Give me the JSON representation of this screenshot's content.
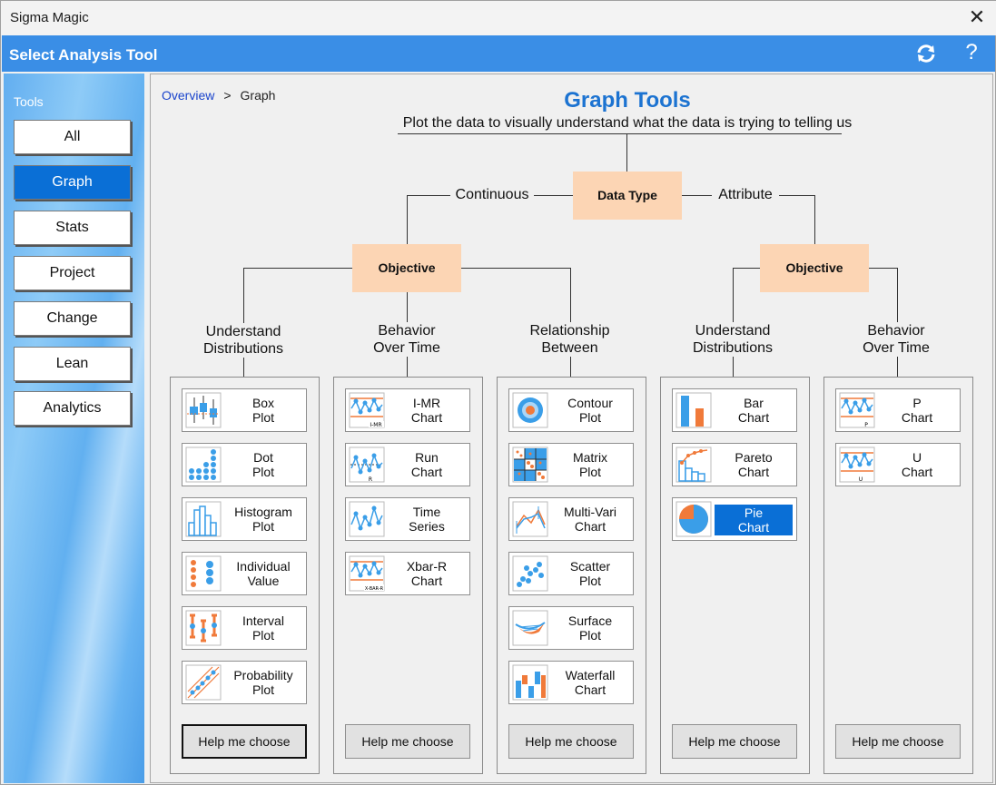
{
  "window": {
    "title": "Sigma Magic"
  },
  "header": {
    "title": "Select Analysis Tool",
    "help": "?"
  },
  "sidebar": {
    "label": "Tools",
    "items": [
      {
        "label": "All",
        "active": false
      },
      {
        "label": "Graph",
        "active": true
      },
      {
        "label": "Stats",
        "active": false
      },
      {
        "label": "Project",
        "active": false
      },
      {
        "label": "Change",
        "active": false
      },
      {
        "label": "Lean",
        "active": false
      },
      {
        "label": "Analytics",
        "active": false
      }
    ]
  },
  "breadcrumb": {
    "link": "Overview",
    "sep": ">",
    "current": "Graph"
  },
  "page": {
    "title": "Graph Tools",
    "subtitle": "Plot the data to visually understand what the data is trying to telling us"
  },
  "tree": {
    "root": "Data Type",
    "left_branch": "Continuous",
    "right_branch": "Attribute",
    "objective": "Objective"
  },
  "columns": [
    {
      "heading": [
        "Understand",
        "Distributions"
      ],
      "tools": [
        [
          "Box",
          "Plot"
        ],
        [
          "Dot",
          "Plot"
        ],
        [
          "Histogram",
          "Plot"
        ],
        [
          "Individual",
          "Value"
        ],
        [
          "Interval",
          "Plot"
        ],
        [
          "Probability",
          "Plot"
        ]
      ],
      "help": "Help me choose"
    },
    {
      "heading": [
        "Behavior",
        "Over Time"
      ],
      "tools": [
        [
          "I-MR",
          "Chart"
        ],
        [
          "Run",
          "Chart"
        ],
        [
          "Time",
          "Series"
        ],
        [
          "Xbar-R",
          "Chart"
        ]
      ],
      "help": "Help me choose"
    },
    {
      "heading": [
        "Relationship",
        "Between"
      ],
      "tools": [
        [
          "Contour",
          "Plot"
        ],
        [
          "Matrix",
          "Plot"
        ],
        [
          "Multi-Vari",
          "Chart"
        ],
        [
          "Scatter",
          "Plot"
        ],
        [
          "Surface",
          "Plot"
        ],
        [
          "Waterfall",
          "Chart"
        ]
      ],
      "help": "Help me choose"
    },
    {
      "heading": [
        "Understand",
        "Distributions"
      ],
      "tools": [
        [
          "Bar",
          "Chart"
        ],
        [
          "Pareto",
          "Chart"
        ],
        [
          "Pie",
          "Chart"
        ]
      ],
      "help": "Help me choose"
    },
    {
      "heading": [
        "Behavior",
        "Over Time"
      ],
      "tools": [
        [
          "P",
          "Chart"
        ],
        [
          "U",
          "Chart"
        ]
      ],
      "help": "Help me choose"
    }
  ],
  "icon_badges": {
    "imr": "I-MR",
    "run": "R",
    "xbar": "X-BAR-R",
    "p": "P",
    "u": "U"
  },
  "colors": {
    "accent": "#3a8ee6",
    "selected": "#0a6fd6",
    "objective": "#fcd5b4",
    "icon_blue": "#3a9ee8",
    "icon_orange": "#f07a3a"
  }
}
